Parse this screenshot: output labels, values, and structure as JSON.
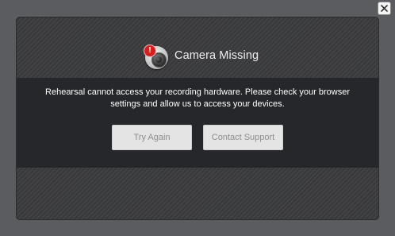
{
  "dialog": {
    "title": "Camera Missing",
    "alert_mark": "!",
    "icon": "camera-alert-icon",
    "message_line1": "Rehearsal cannot access your recording hardware. Please check your browser",
    "message_line2": "settings and allow us to access your devices.",
    "buttons": {
      "try_again": "Try Again",
      "contact_support": "Contact Support"
    },
    "close_icon": "close-icon"
  },
  "colors": {
    "page_bg": "#5b5c5f",
    "panel_bg": "#3b3c3e",
    "message_band_bg": "#25272a",
    "button_bg": "#e4e4e4",
    "button_text": "#8e8e8e",
    "alert_red": "#d41f1f"
  }
}
